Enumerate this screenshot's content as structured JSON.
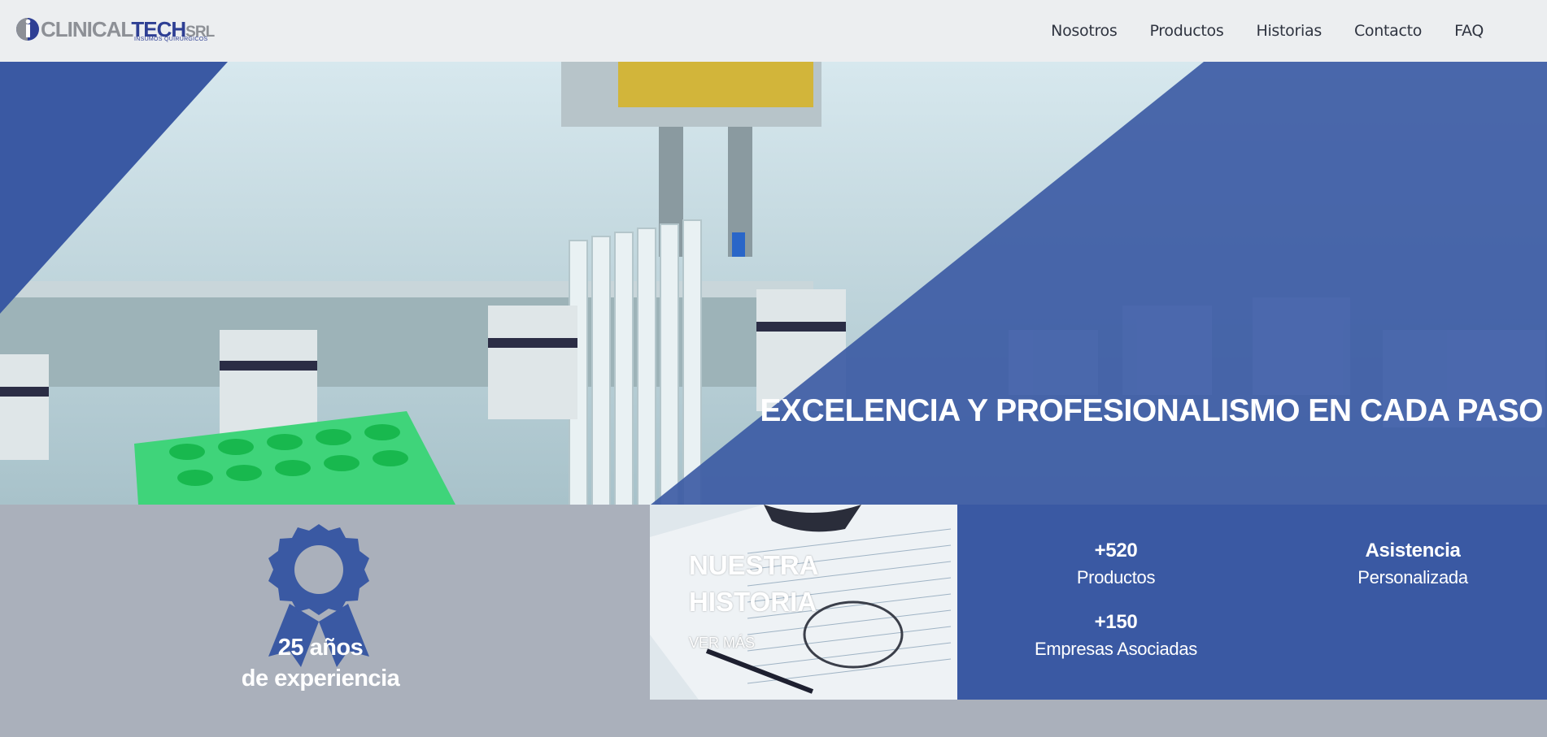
{
  "brand": {
    "logo_part1": "CLINICAL",
    "logo_part2": "TECH",
    "logo_part3": "SRL",
    "tagline": "INSUMOS QUIRÚRGICOS"
  },
  "nav": {
    "items": [
      "Nosotros",
      "Productos",
      "Historias",
      "Contacto",
      "FAQ"
    ]
  },
  "hero": {
    "title": "EXCELENCIA Y PROFESIONALISMO EN CADA PASO"
  },
  "experience": {
    "number": "25 años",
    "label": "de experiencia"
  },
  "story": {
    "title_line1": "NUESTRA",
    "title_line2": "HISTORIA",
    "link": "VER MÁS"
  },
  "stats": {
    "products_num": "+520",
    "products_label": "Productos",
    "companies_num": "+150",
    "companies_label": "Empresas Asociadas",
    "assist_title": "Asistencia",
    "assist_label": "Personalizada"
  },
  "colors": {
    "brand_blue": "#3a59a3",
    "navbar_bg": "#eceef0",
    "section_gray": "#aab0bb"
  },
  "icons": {
    "badge": "award-ribbon-icon"
  }
}
